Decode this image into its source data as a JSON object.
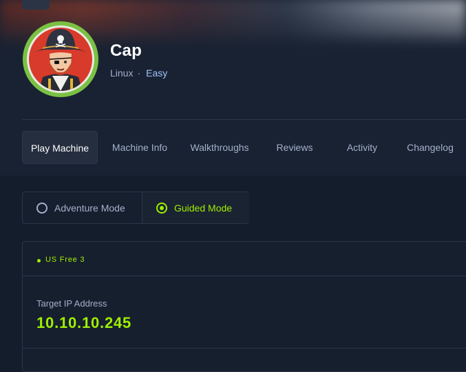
{
  "machine": {
    "name": "Cap",
    "os": "Linux",
    "separator": "·",
    "difficulty": "Easy",
    "avatar_icon": "pirate-avatar-icon"
  },
  "tabs": [
    {
      "label": "Play Machine",
      "active": true
    },
    {
      "label": "Machine Info",
      "active": false
    },
    {
      "label": "Walkthroughs",
      "active": false
    },
    {
      "label": "Reviews",
      "active": false
    },
    {
      "label": "Activity",
      "active": false
    },
    {
      "label": "Changelog",
      "active": false
    }
  ],
  "modes": {
    "adventure": {
      "label": "Adventure Mode",
      "selected": false
    },
    "guided": {
      "label": "Guided Mode",
      "selected": true
    }
  },
  "server": {
    "name": "US Free 3",
    "status": "online"
  },
  "target": {
    "label": "Target IP Address",
    "ip": "10.10.10.245"
  },
  "colors": {
    "background": "#141d2b",
    "header": "#192232",
    "accent": "#9fef00",
    "muted_text": "#a4b1cd",
    "difficulty": "#9fc4ff"
  }
}
